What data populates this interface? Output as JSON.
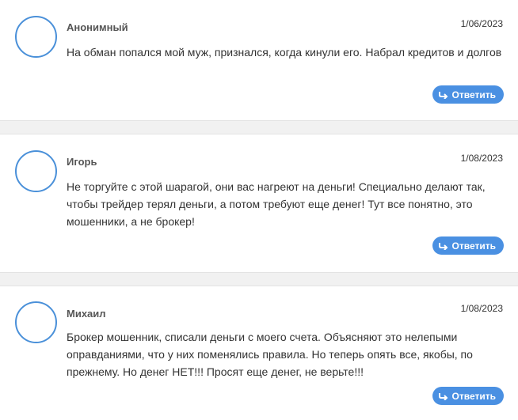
{
  "comments": [
    {
      "author": "Анонимный",
      "date": "1/06/2023",
      "text": "На обман попался мой муж, признался, когда кинули его. Набрал кредитов и долгов",
      "reply_label": "Ответить"
    },
    {
      "author": "Игорь",
      "date": "1/08/2023",
      "text": "Не торгуйте с этой шарагой, они вас нагреют на деньги! Специально делают так, чтобы трейдер терял деньги, а потом требуют еще денег! Тут все понятно, это мошенники, а не брокер!",
      "reply_label": "Ответить"
    },
    {
      "author": "Михаил",
      "date": "1/08/2023",
      "text": "Брокер мошенник, списали деньги с моего счета. Объясняют это нелепыми оправданиями, что у них поменялись правила. Но теперь опять все, якобы, по прежнему. Но денег НЕТ!!! Просят еще денег, не верьте!!!",
      "reply_label": "Ответить"
    }
  ],
  "colors": {
    "accent": "#4a90e2",
    "avatar_border": "#4a90d9",
    "separator": "#f1f1f1"
  },
  "icons": {
    "reply": "reply-arrow-icon"
  }
}
